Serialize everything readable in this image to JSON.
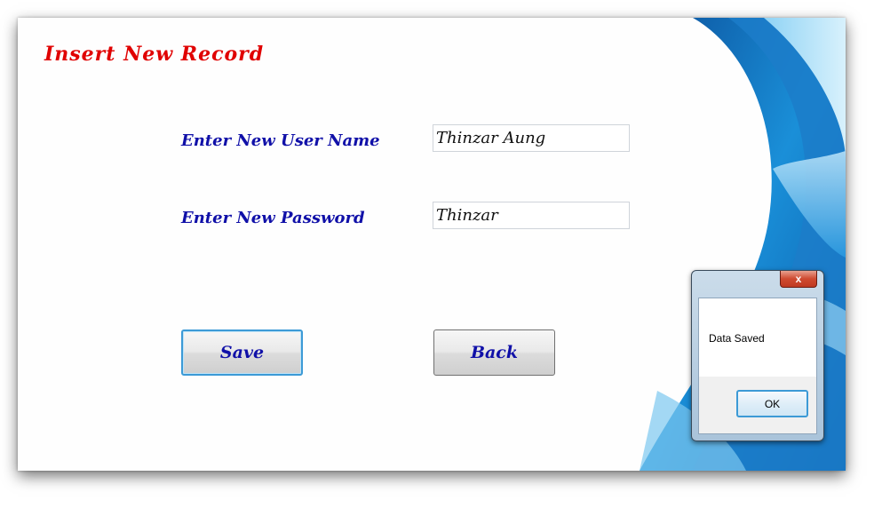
{
  "form": {
    "title": "Insert New Record",
    "username_label": "Enter New User Name",
    "username_value": "Thinzar Aung",
    "password_label": "Enter New Password",
    "password_value": "Thinzar",
    "save_label": "Save",
    "back_label": "Back"
  },
  "dialog": {
    "message": "Data Saved",
    "ok_label": "OK",
    "close_symbol": "x"
  },
  "colors": {
    "title": "#e00000",
    "labels": "#1010a8",
    "accent_blue": "#1a78c2"
  }
}
